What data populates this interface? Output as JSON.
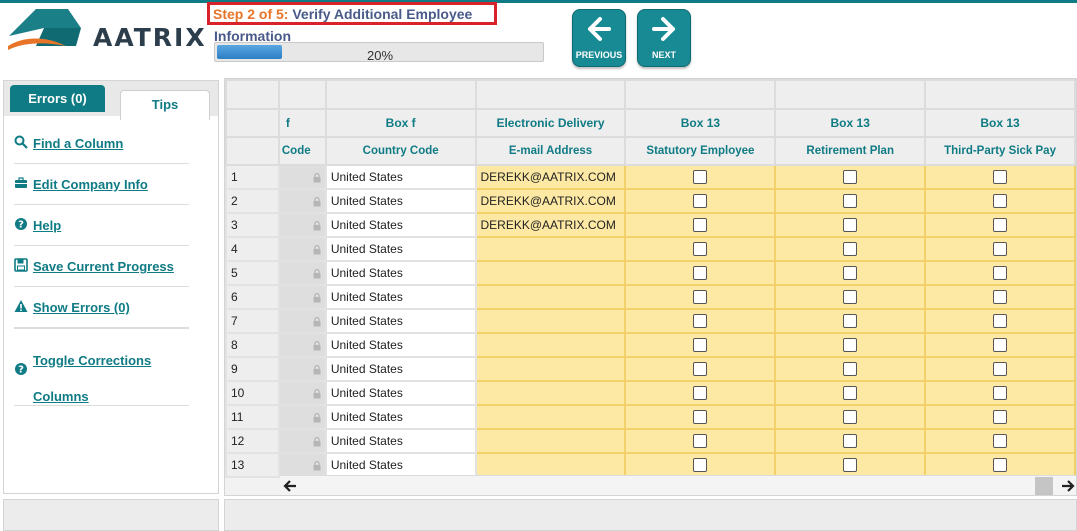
{
  "brand": {
    "name": "AATRIX"
  },
  "wizard": {
    "step_prefix": "Step 2 of 5:",
    "step_title": " Verify Additional Employee",
    "step_subtitle": "Information",
    "progress_value": 20,
    "progress_text": "20%"
  },
  "nav": {
    "previous_label": "PREVIOUS",
    "next_label": "NEXT"
  },
  "left_panel": {
    "tabs": [
      {
        "label": "Errors (0)",
        "active": false
      },
      {
        "label": "Tips",
        "active": true
      }
    ],
    "tips": [
      {
        "label": "Find a Column",
        "icon": "search-icon"
      },
      {
        "label": "Edit Company Info",
        "icon": "briefcase-icon"
      },
      {
        "label": "Help",
        "icon": "help-icon"
      },
      {
        "label": "Save Current Progress",
        "icon": "save-icon"
      },
      {
        "label": "Show Errors (0)",
        "icon": "warning-icon"
      },
      {
        "label": "Toggle Corrections Columns",
        "icon": "help-icon"
      }
    ]
  },
  "grid": {
    "header_row1": [
      "f",
      "Box f",
      "Electronic Delivery",
      "Box 13",
      "Box 13",
      "Box 13"
    ],
    "header_row2": [
      "Code",
      "Country Code",
      "E-mail Address",
      "Statutory Employee",
      "Retirement Plan",
      "Third-Party Sick Pay"
    ],
    "rows": [
      {
        "num": "1",
        "country": "United States",
        "email": "DEREKK@AATRIX.COM"
      },
      {
        "num": "2",
        "country": "United States",
        "email": "DEREKK@AATRIX.COM"
      },
      {
        "num": "3",
        "country": "United States",
        "email": "DEREKK@AATRIX.COM"
      },
      {
        "num": "4",
        "country": "United States",
        "email": ""
      },
      {
        "num": "5",
        "country": "United States",
        "email": ""
      },
      {
        "num": "6",
        "country": "United States",
        "email": ""
      },
      {
        "num": "7",
        "country": "United States",
        "email": ""
      },
      {
        "num": "8",
        "country": "United States",
        "email": ""
      },
      {
        "num": "9",
        "country": "United States",
        "email": ""
      },
      {
        "num": "10",
        "country": "United States",
        "email": ""
      },
      {
        "num": "11",
        "country": "United States",
        "email": ""
      },
      {
        "num": "12",
        "country": "United States",
        "email": ""
      },
      {
        "num": "13",
        "country": "United States",
        "email": ""
      }
    ]
  },
  "colors": {
    "accent": "#0f7b84",
    "highlight_border": "#d8232a",
    "input_yellow": "#fde9a4",
    "step_orange": "#e8742a"
  }
}
